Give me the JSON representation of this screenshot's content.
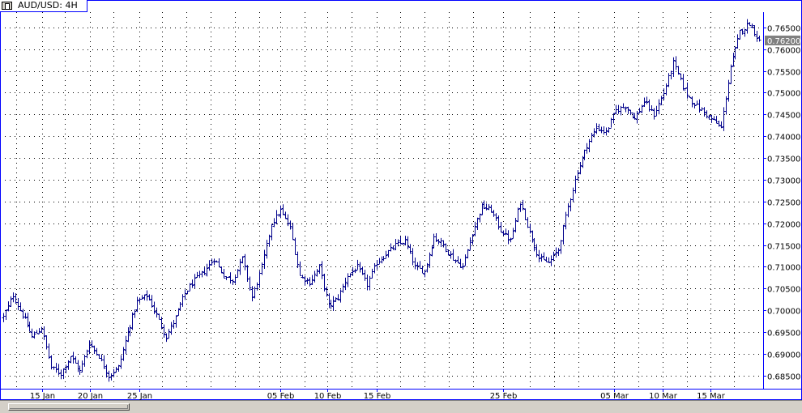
{
  "window": {
    "title": "AUD/USD: 4H"
  },
  "colors": {
    "bar": "#00008b",
    "frame": "#0000ff",
    "grid": "#000000",
    "price_tag_bg": "#808080",
    "price_tag_text": "#ffffff"
  },
  "chart_data": {
    "type": "ohlc",
    "title": "AUD/USD: 4H",
    "xlabel": "",
    "ylabel": "",
    "ylim": [
      0.682,
      0.7685
    ],
    "grid": true,
    "y_ticks": [
      "0.76500",
      "0.76000",
      "0.75500",
      "0.75000",
      "0.74500",
      "0.74000",
      "0.73500",
      "0.73000",
      "0.72500",
      "0.72000",
      "0.71500",
      "0.71000",
      "0.70500",
      "0.70000",
      "0.69500",
      "0.69000",
      "0.68500"
    ],
    "x_ticks": [
      "15 Jan",
      "20 Jan",
      "25 Jan",
      "05 Feb",
      "10 Feb",
      "15 Feb",
      "25 Feb",
      "05 Mar",
      "10 Mar",
      "15 Mar"
    ],
    "current_price": "0.76200",
    "anchors": [
      0.6985,
      0.7035,
      0.699,
      0.694,
      0.696,
      0.687,
      0.6855,
      0.6895,
      0.686,
      0.6925,
      0.6895,
      0.685,
      0.687,
      0.695,
      0.702,
      0.7035,
      0.699,
      0.694,
      0.6985,
      0.704,
      0.707,
      0.709,
      0.712,
      0.708,
      0.707,
      0.712,
      0.703,
      0.71,
      0.72,
      0.723,
      0.719,
      0.708,
      0.7065,
      0.71,
      0.701,
      0.703,
      0.708,
      0.71,
      0.706,
      0.711,
      0.713,
      0.715,
      0.716,
      0.71,
      0.709,
      0.717,
      0.715,
      0.712,
      0.71,
      0.718,
      0.724,
      0.723,
      0.7185,
      0.716,
      0.725,
      0.718,
      0.712,
      0.711,
      0.714,
      0.724,
      0.732,
      0.738,
      0.742,
      0.741,
      0.746,
      0.747,
      0.744,
      0.748,
      0.745,
      0.75,
      0.757,
      0.7515,
      0.748,
      0.746,
      0.744,
      0.742,
      0.756,
      0.764,
      0.766,
      0.762
    ]
  }
}
